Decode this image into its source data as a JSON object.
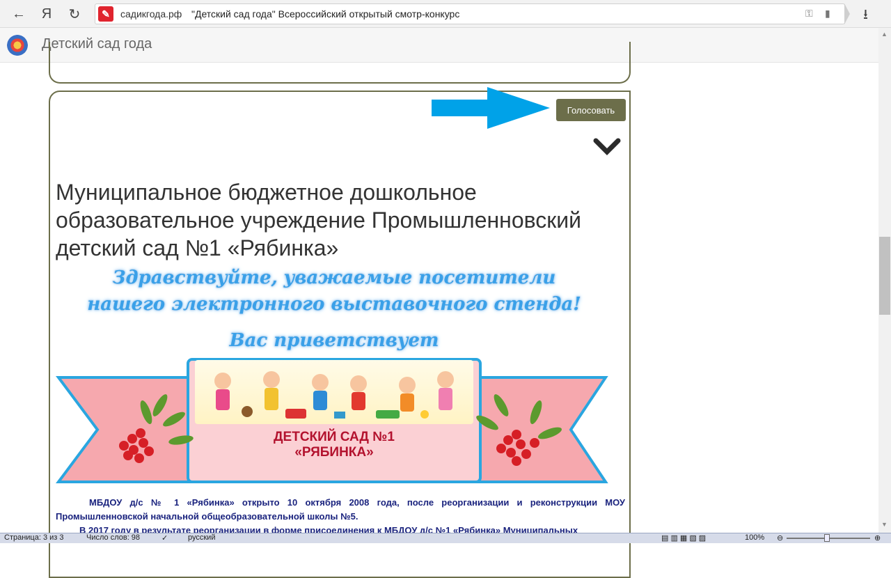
{
  "browser": {
    "url_domain": "садикгода.рф",
    "page_title": "\"Детский сад года\" Всероссийский открытый смотр-конкурс",
    "back_glyph": "←",
    "yandex_glyph": "Я",
    "reload_glyph": "↻",
    "download_glyph": "⭳",
    "icons": [
      "back-icon",
      "yandex-icon",
      "reload-icon",
      "key-icon",
      "bookmark-icon",
      "download-icon"
    ]
  },
  "site": {
    "title": "Детский сад года"
  },
  "card": {
    "vote_label": "Голосовать",
    "org_title": "Муниципальное бюджетное дошкольное образовательное учреждение Промышленновский детский сад №1 «Рябинка»",
    "banner": {
      "greeting_line1": "Здравствуйте, уважаемые посетители",
      "greeting_line2": "нашего электронного выставочного стенда!",
      "greeting_line3": "Вас приветствует",
      "ribbon_line1": "ДЕТСКИЙ САД №1",
      "ribbon_line2": "«РЯБИНКА»"
    },
    "paragraph1": "МБДОУ д/с № 1 «Рябинка» открыто 10 октября 2008 года, после реорганизации и реконструкции МОУ Промышленновской начальной общеобразовательной школы №5.",
    "paragraph2": "В 2017 году в результате реорганизации в форме присоединения к МБДОУ д/с №1 «Рябинка» Муниципальных"
  },
  "statusbar": {
    "page": "Страница: 3 из 3",
    "words": "Число слов: 98",
    "language": "русский",
    "zoom": "100%"
  },
  "colors": {
    "accent": "#6c6e4a",
    "arrow": "#00a2e8",
    "paragraph_text": "#1a237e",
    "ribbon_text": "#b3122e"
  }
}
